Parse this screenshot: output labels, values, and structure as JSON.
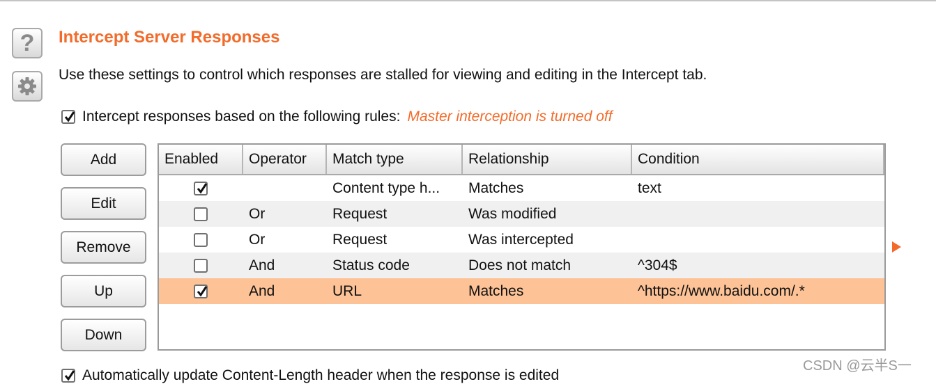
{
  "section": {
    "title": "Intercept Server Responses",
    "description": "Use these settings to control which responses are stalled for viewing and editing in the Intercept tab.",
    "help_glyph": "?",
    "icons": {
      "help": "help-icon",
      "settings": "gear-icon"
    }
  },
  "rules_option": {
    "checked": true,
    "label": "Intercept responses based on the following rules:",
    "note": "Master interception is turned off"
  },
  "buttons": {
    "add": "Add",
    "edit": "Edit",
    "remove": "Remove",
    "up": "Up",
    "down": "Down"
  },
  "table": {
    "columns": [
      "Enabled",
      "Operator",
      "Match type",
      "Relationship",
      "Condition"
    ],
    "rows": [
      {
        "enabled": true,
        "operator": "",
        "match_type": "Content type h...",
        "relationship": "Matches",
        "condition": "text"
      },
      {
        "enabled": false,
        "operator": "Or",
        "match_type": "Request",
        "relationship": "Was modified",
        "condition": ""
      },
      {
        "enabled": false,
        "operator": "Or",
        "match_type": "Request",
        "relationship": "Was intercepted",
        "condition": ""
      },
      {
        "enabled": false,
        "operator": "And",
        "match_type": "Status code",
        "relationship": "Does not match",
        "condition": "^304$"
      },
      {
        "enabled": true,
        "operator": "And",
        "match_type": "URL",
        "relationship": "Matches",
        "condition": "^https://www.baidu.com/.*",
        "selected": true
      }
    ]
  },
  "auto_update_option": {
    "checked": true,
    "label": "Automatically update Content-Length header when the response is edited"
  },
  "watermark": "CSDN @云半S一",
  "colors": {
    "accent": "#f26b2a",
    "selected_row": "#fdc397"
  }
}
